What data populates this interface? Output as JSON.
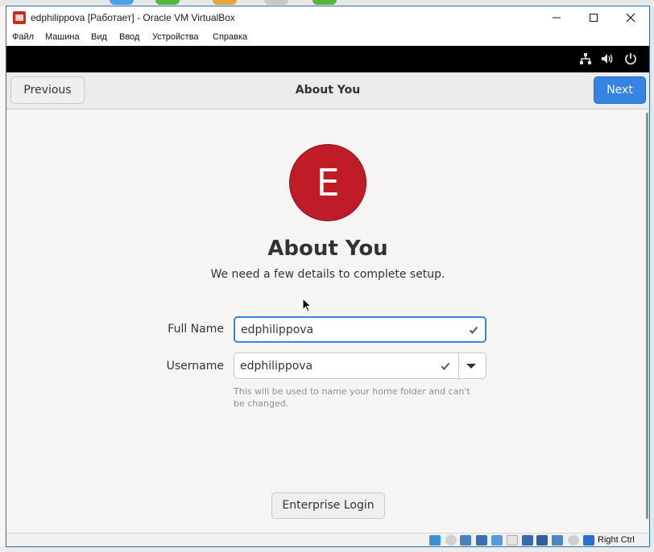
{
  "window": {
    "title": "edphilippova [Работает] - Oracle VM VirtualBox",
    "minimize_icon": "minimize-icon",
    "maximize_icon": "maximize-icon",
    "close_icon": "close-icon"
  },
  "menu": [
    "Файл",
    "Машина",
    "Вид",
    "Ввод",
    "Устройства",
    "Справка"
  ],
  "system_icons": [
    "network-icon",
    "volume-icon",
    "power-icon"
  ],
  "header": {
    "previous_label": "Previous",
    "title": "About You",
    "next_label": "Next"
  },
  "avatar": {
    "initial": "E",
    "color": "#c01c28"
  },
  "content": {
    "heading": "About You",
    "subtitle": "We need a few details to complete setup."
  },
  "form": {
    "full_name_label": "Full Name",
    "full_name_value": "edphilippova",
    "username_label": "Username",
    "username_value": "edphilippova",
    "username_hint": "This will be used to name your home folder and can't be changed."
  },
  "enterprise_login_label": "Enterprise Login",
  "statusbar": {
    "host_key": "Right Ctrl",
    "icons": [
      "optical-drive-icon",
      "audio-icon",
      "usb-icon",
      "shared-folders-icon",
      "network-icon",
      "display-icon",
      "recording-icon",
      "vm-state-icon",
      "cpu-icon",
      "mouse-integration-icon",
      "keyboard-capture-icon"
    ]
  },
  "colors": {
    "accent": "#3584e4",
    "avatar": "#c01c28"
  }
}
